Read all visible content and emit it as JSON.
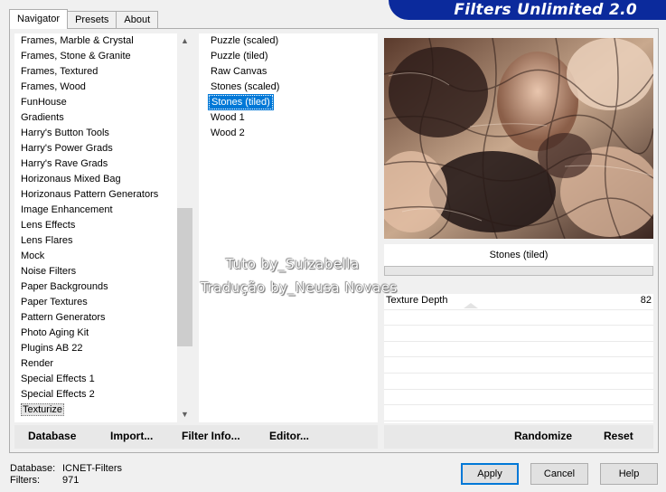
{
  "tabs": [
    {
      "label": "Navigator",
      "active": true
    },
    {
      "label": "Presets",
      "active": false
    },
    {
      "label": "About",
      "active": false
    }
  ],
  "banner": {
    "title": "Filters Unlimited 2.0"
  },
  "categories": {
    "items": [
      "Frames, Marble & Crystal",
      "Frames, Stone & Granite",
      "Frames, Textured",
      "Frames, Wood",
      "FunHouse",
      "Gradients",
      "Harry's Button Tools",
      "Harry's Power Grads",
      "Harry's Rave Grads",
      "Horizonaus Mixed Bag",
      "Horizonaus Pattern Generators",
      "Image Enhancement",
      "Lens Effects",
      "Lens Flares",
      "Mock",
      "Noise Filters",
      "Paper Backgrounds",
      "Paper Textures",
      "Pattern Generators",
      "Photo Aging Kit",
      "Plugins AB 22",
      "Render",
      "Special Effects 1",
      "Special Effects 2",
      "Texturize"
    ],
    "selected": "Texturize"
  },
  "filters": {
    "items": [
      "Puzzle (scaled)",
      "Puzzle (tiled)",
      "Raw Canvas",
      "Stones (scaled)",
      "Stones (tiled)",
      "Wood 1",
      "Wood 2"
    ],
    "selected": "Stones (tiled)"
  },
  "preview": {
    "filter_title": "Stones (tiled)"
  },
  "params": [
    {
      "label": "Texture Depth",
      "value": "82"
    }
  ],
  "link_buttons": {
    "database": "Database",
    "import": "Import...",
    "filter_info": "Filter Info...",
    "editor": "Editor...",
    "randomize": "Randomize",
    "reset": "Reset"
  },
  "status": {
    "database_label": "Database:",
    "database_value": "ICNET-Filters",
    "filters_label": "Filters:",
    "filters_value": "971"
  },
  "dialog_buttons": {
    "apply": "Apply",
    "cancel": "Cancel",
    "help": "Help"
  },
  "watermark": {
    "line1": "Tuto by_Suizabella",
    "line2": "Tradução by_Neusa Novaes"
  },
  "colors": {
    "banner": "#0b2a9c",
    "selection": "#0078d7"
  }
}
